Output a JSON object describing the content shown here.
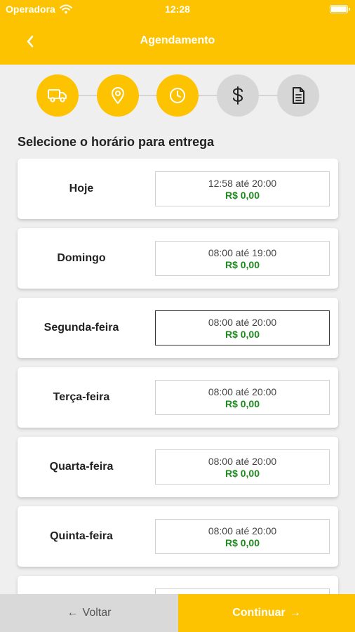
{
  "status_bar": {
    "carrier": "Operadora",
    "time": "12:28"
  },
  "header": {
    "title": "Agendamento"
  },
  "steps": [
    {
      "icon": "truck-icon",
      "state": "active"
    },
    {
      "icon": "location-pin-icon",
      "state": "active"
    },
    {
      "icon": "clock-icon",
      "state": "active"
    },
    {
      "icon": "dollar-icon",
      "state": "inactive"
    },
    {
      "icon": "document-icon",
      "state": "inactive"
    }
  ],
  "section_title": "Selecione o horário para entrega",
  "days": [
    {
      "label": "Hoje",
      "range": "12:58 até 20:00",
      "price": "R$ 0,00",
      "selected": false
    },
    {
      "label": "Domingo",
      "range": "08:00 até 19:00",
      "price": "R$ 0,00",
      "selected": false
    },
    {
      "label": "Segunda-feira",
      "range": "08:00 até 20:00",
      "price": "R$ 0,00",
      "selected": true
    },
    {
      "label": "Terça-feira",
      "range": "08:00 até 20:00",
      "price": "R$ 0,00",
      "selected": false
    },
    {
      "label": "Quarta-feira",
      "range": "08:00 até 20:00",
      "price": "R$ 0,00",
      "selected": false
    },
    {
      "label": "Quinta-feira",
      "range": "08:00 até 20:00",
      "price": "R$ 0,00",
      "selected": false
    }
  ],
  "footer": {
    "back_label": "Voltar",
    "next_label": "Continuar"
  },
  "colors": {
    "accent": "#fdc300",
    "price": "#1e8a1e",
    "inactive_step": "#d6d6d6"
  }
}
